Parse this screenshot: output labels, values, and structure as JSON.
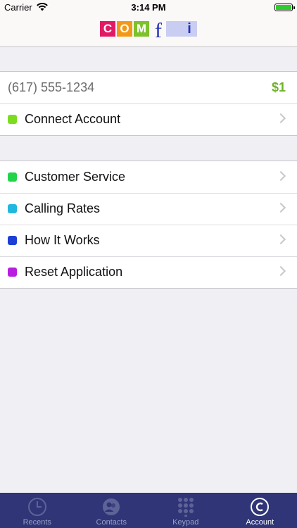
{
  "status_bar": {
    "carrier": "Carrier",
    "time": "3:14 PM"
  },
  "header": {
    "logo": {
      "letters": [
        "C",
        "O",
        "M",
        "f",
        "i"
      ]
    }
  },
  "account": {
    "phone": "(617) 555-1234",
    "balance": "$1",
    "connect_label": "Connect Account",
    "connect_color": "#7ddc1f"
  },
  "menu": {
    "items": [
      {
        "label": "Customer Service",
        "color": "#21d44a"
      },
      {
        "label": "Calling Rates",
        "color": "#21b8e0"
      },
      {
        "label": "How It Works",
        "color": "#1c3fd6"
      },
      {
        "label": "Reset Application",
        "color": "#b81ee0"
      }
    ]
  },
  "tabbar": {
    "tabs": [
      {
        "label": "Recents",
        "icon": "clock-icon",
        "active": false
      },
      {
        "label": "Contacts",
        "icon": "contacts-icon",
        "active": false
      },
      {
        "label": "Keypad",
        "icon": "keypad-icon",
        "active": false
      },
      {
        "label": "Account",
        "icon": "account-c-icon",
        "active": true
      }
    ]
  }
}
